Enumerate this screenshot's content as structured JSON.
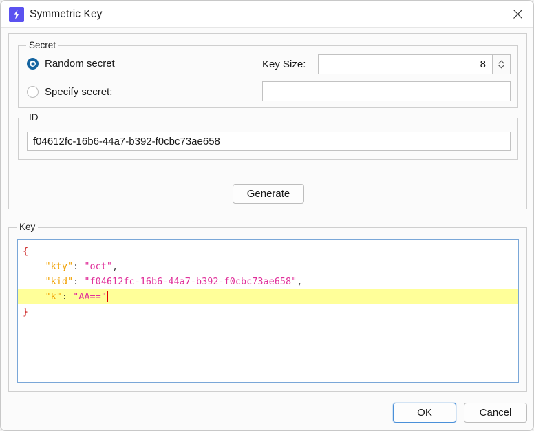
{
  "window": {
    "title": "Symmetric Key",
    "app_icon": "lightning-bolt-icon",
    "close_label": "✕"
  },
  "secret": {
    "legend": "Secret",
    "options": [
      {
        "label": "Random secret",
        "selected": true
      },
      {
        "label": "Specify secret:",
        "selected": false
      }
    ],
    "key_size_label": "Key Size:",
    "key_size_value": "8",
    "specify_secret_value": "",
    "specify_secret_placeholder": ""
  },
  "id": {
    "legend": "ID",
    "value": "f04612fc-16b6-44a7-b392-f0cbc73ae658",
    "placeholder": ""
  },
  "actions": {
    "generate_label": "Generate"
  },
  "key_panel": {
    "legend": "Key",
    "lines": [
      {
        "open_brace": "{"
      },
      {
        "indent": "    ",
        "key": "\"kty\"",
        "colon": ": ",
        "value": "\"oct\"",
        "comma": ","
      },
      {
        "indent": "    ",
        "key": "\"kid\"",
        "colon": ": ",
        "value": "\"f04612fc-16b6-44a7-b392-f0cbc73ae658\"",
        "comma": ","
      },
      {
        "indent": "    ",
        "key": "\"k\"",
        "colon": ": ",
        "value": "\"AA==\"",
        "comma": "",
        "highlighted": true,
        "caret": true
      },
      {
        "close_brace": "}"
      }
    ]
  },
  "footer": {
    "ok_label": "OK",
    "cancel_label": "Cancel"
  },
  "colors": {
    "accent": "#5b52f0",
    "radio_selected": "#1464a0",
    "focus_border": "#7aa7d8",
    "highlight_line": "#ffff99",
    "json_key": "#f0a000",
    "json_string": "#e0309a",
    "json_brace": "#cc2222",
    "caret": "#e00000"
  }
}
